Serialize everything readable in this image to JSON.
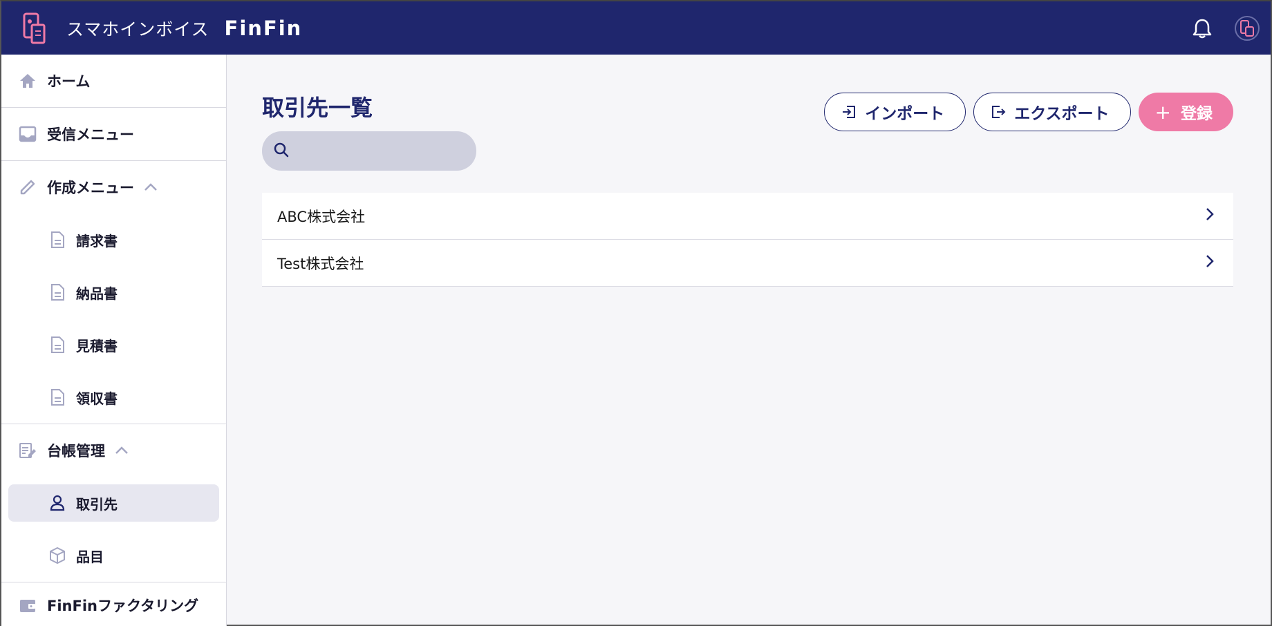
{
  "header": {
    "app_name": "スマホインボイス",
    "brand": "FinFin"
  },
  "sidebar": {
    "home": "ホーム",
    "inbox": "受信メニュー",
    "create_menu": "作成メニュー",
    "create_items": [
      "請求書",
      "納品書",
      "見積書",
      "領収書"
    ],
    "ledger": "台帳管理",
    "ledger_items": [
      "取引先",
      "品目"
    ],
    "factoring": "FinFinファクタリング"
  },
  "main": {
    "title": "取引先一覧",
    "search": {
      "placeholder": "",
      "value": ""
    },
    "buttons": {
      "import": "インポート",
      "export": "エクスポート",
      "register": "登録"
    },
    "clients": [
      "ABC株式会社",
      "Test株式会社"
    ]
  },
  "colors": {
    "header_bg": "#1f266d",
    "accent_pink": "#ef7aa6",
    "text_navy": "#1f266d"
  }
}
